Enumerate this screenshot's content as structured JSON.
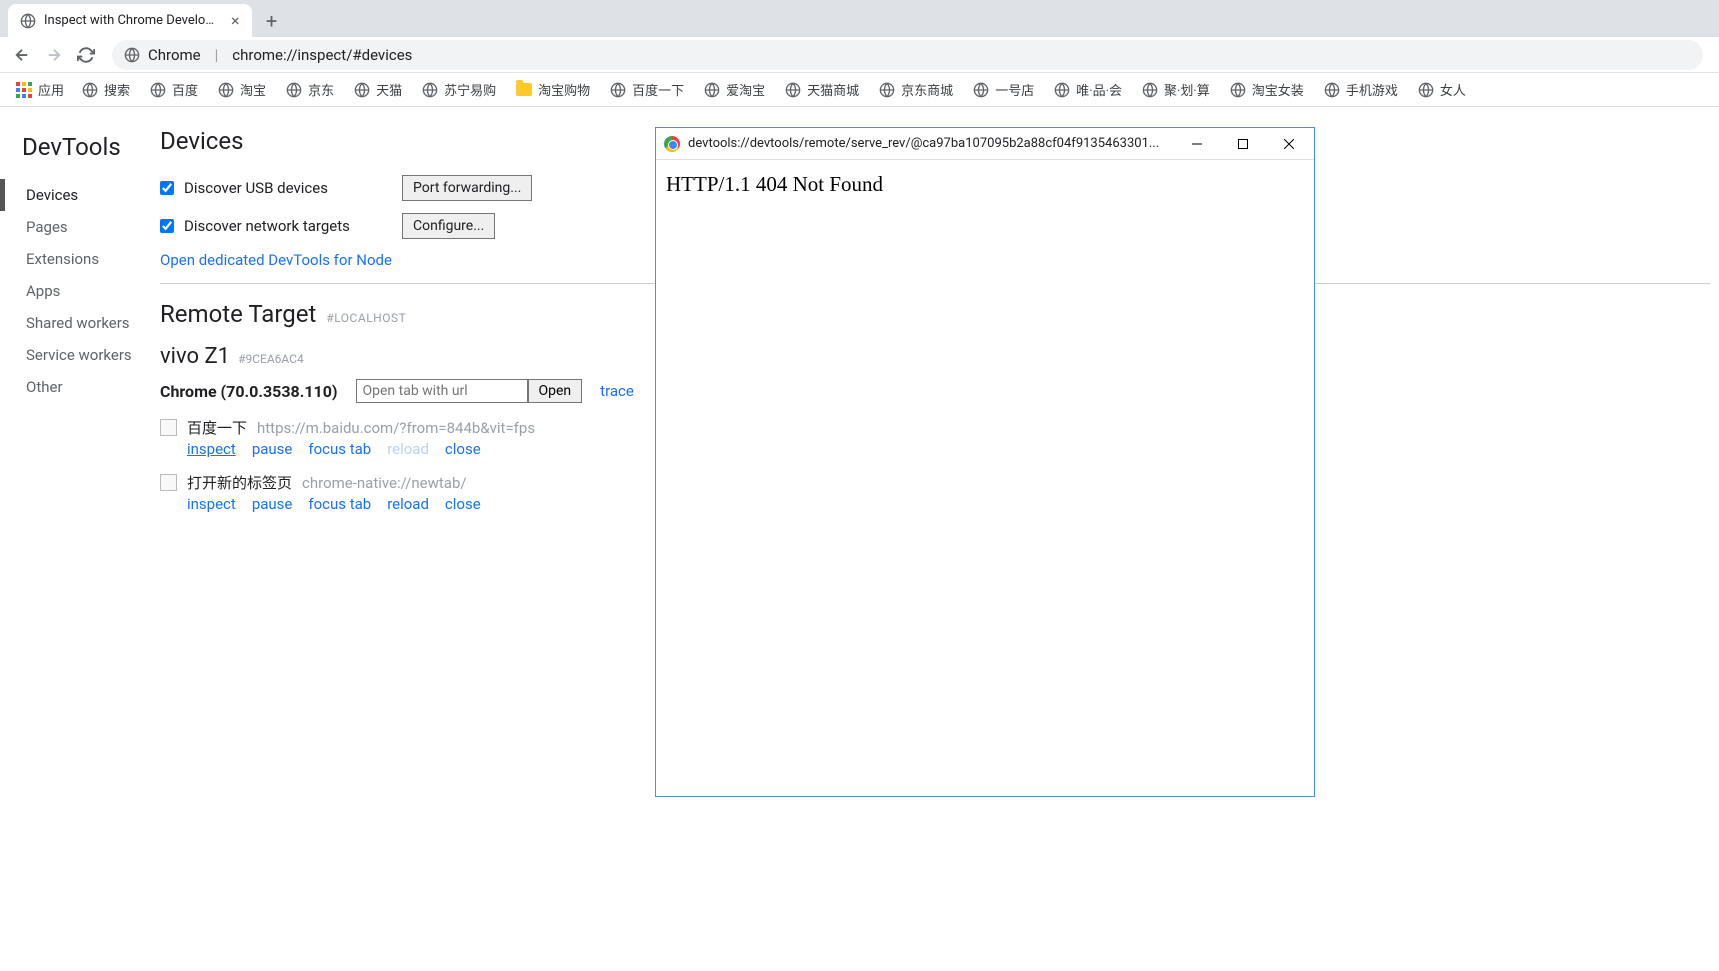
{
  "tab": {
    "title": "Inspect with Chrome Develope"
  },
  "address": {
    "host": "Chrome",
    "url": "chrome://inspect/#devices"
  },
  "bookmarks": {
    "apps_label": "应用",
    "items": [
      {
        "label": "搜索",
        "icon": "globe"
      },
      {
        "label": "百度",
        "icon": "globe"
      },
      {
        "label": "淘宝",
        "icon": "globe"
      },
      {
        "label": "京东",
        "icon": "globe"
      },
      {
        "label": "天猫",
        "icon": "globe"
      },
      {
        "label": "苏宁易购",
        "icon": "globe"
      },
      {
        "label": "淘宝购物",
        "icon": "folder"
      },
      {
        "label": "百度一下",
        "icon": "globe"
      },
      {
        "label": "爱淘宝",
        "icon": "globe"
      },
      {
        "label": "天猫商城",
        "icon": "globe"
      },
      {
        "label": "京东商城",
        "icon": "globe"
      },
      {
        "label": "一号店",
        "icon": "globe"
      },
      {
        "label": "唯·品·会",
        "icon": "globe"
      },
      {
        "label": "聚·划·算",
        "icon": "globe"
      },
      {
        "label": "淘宝女装",
        "icon": "globe"
      },
      {
        "label": "手机游戏",
        "icon": "globe"
      },
      {
        "label": "女人",
        "icon": "globe"
      }
    ]
  },
  "sidebar": {
    "title": "DevTools",
    "items": [
      "Devices",
      "Pages",
      "Extensions",
      "Apps",
      "Shared workers",
      "Service workers",
      "Other"
    ]
  },
  "devices": {
    "title": "Devices",
    "discover_usb": "Discover USB devices",
    "discover_net": "Discover network targets",
    "port_fwd_btn": "Port forwarding...",
    "configure_btn": "Configure...",
    "node_link": "Open dedicated DevTools for Node"
  },
  "remote": {
    "title": "Remote Target",
    "hash": "#LOCALHOST",
    "device_name": "vivo Z1",
    "device_hash": "#9CEA6AC4",
    "chrome_label": "Chrome (70.0.3538.110)",
    "open_placeholder": "Open tab with url",
    "open_btn": "Open",
    "trace_link": "trace",
    "targets": [
      {
        "name": "百度一下",
        "url": "https://m.baidu.com/?from=844b&vit=fps",
        "actions": {
          "inspect": "inspect",
          "pause": "pause",
          "focus": "focus tab",
          "reload": "reload",
          "close": "close"
        },
        "inspect_active": true,
        "reload_disabled": true
      },
      {
        "name": "打开新的标签页",
        "url": "chrome-native://newtab/",
        "actions": {
          "inspect": "inspect",
          "pause": "pause",
          "focus": "focus tab",
          "reload": "reload",
          "close": "close"
        },
        "inspect_active": false,
        "reload_disabled": false
      }
    ]
  },
  "popup": {
    "url": "devtools://devtools/remote/serve_rev/@ca97ba107095b2a88cf04f9135463301...",
    "body": "HTTP/1.1 404 Not Found"
  }
}
